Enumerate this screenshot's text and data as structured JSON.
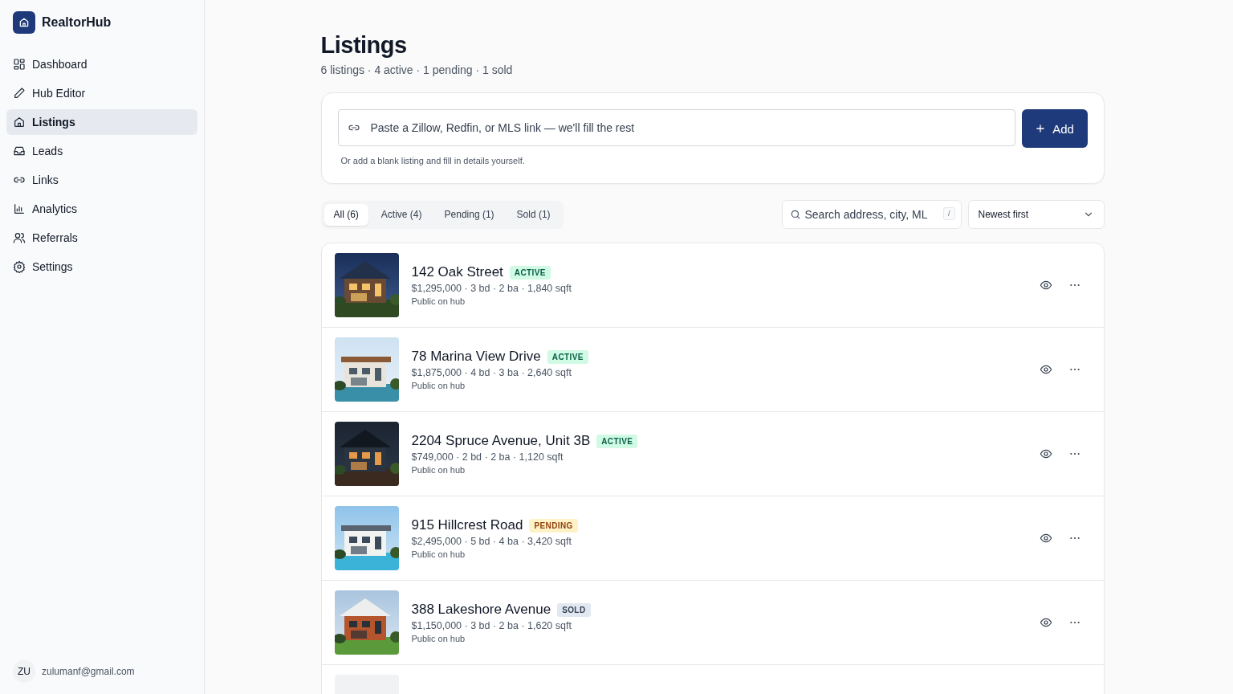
{
  "brand": {
    "name": "RealtorHub"
  },
  "nav": [
    {
      "label": "Dashboard",
      "selected": false
    },
    {
      "label": "Hub Editor",
      "selected": false
    },
    {
      "label": "Listings",
      "selected": true
    },
    {
      "label": "Leads",
      "selected": false
    },
    {
      "label": "Links",
      "selected": false
    },
    {
      "label": "Analytics",
      "selected": false
    },
    {
      "label": "Referrals",
      "selected": false
    },
    {
      "label": "Settings",
      "selected": false
    }
  ],
  "user": {
    "initials": "ZU",
    "email": "zulumanf@gmail.com"
  },
  "page": {
    "title": "Listings",
    "subtitle": "6 listings · 4 active · 1 pending · 1 sold"
  },
  "import": {
    "placeholder": "Paste a Zillow, Redfin, or MLS link — we'll fill the rest",
    "button": "Add",
    "hint": "Or add a blank listing and fill in details yourself."
  },
  "filters": [
    {
      "label": "All (6)",
      "selected": true
    },
    {
      "label": "Active (4)",
      "selected": false
    },
    {
      "label": "Pending (1)",
      "selected": false
    },
    {
      "label": "Sold (1)",
      "selected": false
    }
  ],
  "search": {
    "placeholder": "Search address, city, ML",
    "shortcut": "/"
  },
  "sort": {
    "value": "Newest first"
  },
  "listings": [
    {
      "kind": "picture",
      "address": "142 Oak Street",
      "badge": {
        "label": "ACTIVE",
        "kind": "active"
      },
      "details": "$1,295,000 · 3 bd · 2 ba · 1,840 sqft",
      "visibility": "Public on hub"
    },
    {
      "kind": "picture",
      "address": "78 Marina View Drive",
      "badge": {
        "label": "ACTIVE",
        "kind": "active"
      },
      "details": "$1,875,000 · 4 bd · 3 ba · 2,640 sqft",
      "visibility": "Public on hub"
    },
    {
      "kind": "picture",
      "address": "2204 Spruce Avenue, Unit 3B",
      "badge": {
        "label": "ACTIVE",
        "kind": "active"
      },
      "details": "$749,000 · 2 bd · 2 ba · 1,120 sqft",
      "visibility": "Public on hub"
    },
    {
      "kind": "picture",
      "address": "915 Hillcrest Road",
      "badge": {
        "label": "PENDING",
        "kind": "pending"
      },
      "details": "$2,495,000 · 5 bd · 4 ba · 3,420 sqft",
      "visibility": "Public on hub"
    },
    {
      "kind": "picture",
      "address": "388 Lakeshore Avenue",
      "badge": {
        "label": "SOLD",
        "kind": "sold"
      },
      "details": "$1,150,000 · 3 bd · 2 ba · 1,620 sqft",
      "visibility": "Public on hub"
    },
    {
      "kind": "blank"
    }
  ]
}
